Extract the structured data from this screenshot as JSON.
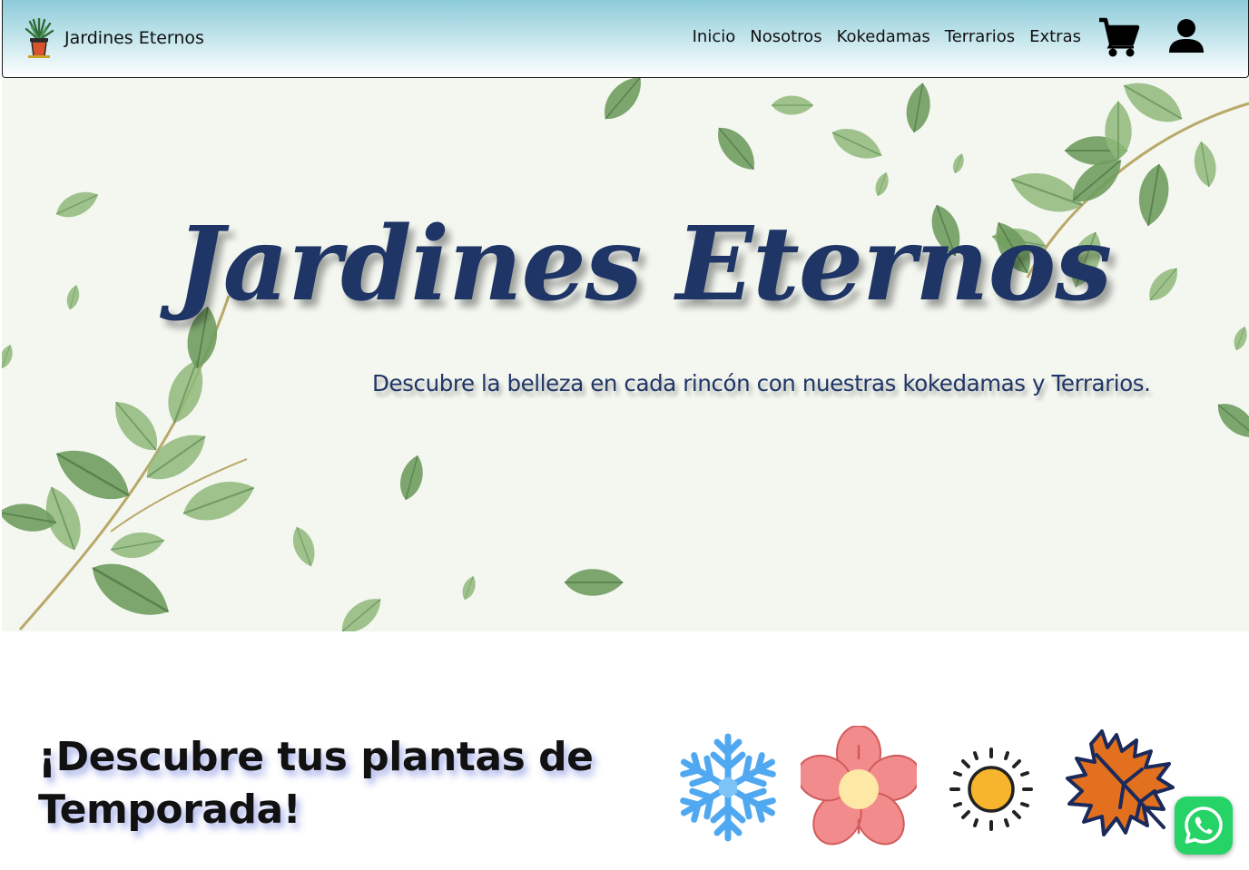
{
  "navbar": {
    "brand_name": "Jardines Eternos",
    "links": [
      {
        "label": "Inicio"
      },
      {
        "label": "Nosotros"
      },
      {
        "label": "Kokedamas"
      },
      {
        "label": "Terrarios"
      },
      {
        "label": "Extras"
      }
    ],
    "icons": {
      "logo": "potted-plant-icon",
      "cart": "shopping-cart-icon",
      "user": "user-account-icon"
    }
  },
  "hero": {
    "title": "Jardines Eternos",
    "subtitle": "Descubre la belleza en cada rincón con nuestras kokedamas y Terrarios.",
    "background": "watercolor-leaves",
    "title_color": "#1f3566"
  },
  "seasons": {
    "heading": "¡Descubre tus plantas de Temporada!",
    "icons": [
      {
        "name": "winter-snowflake-icon",
        "color": "#4fa8f0"
      },
      {
        "name": "spring-flower-icon",
        "color": "#f28b8b"
      },
      {
        "name": "summer-sun-icon",
        "color": "#f6b52c"
      },
      {
        "name": "autumn-leaf-icon",
        "color": "#e2701f"
      }
    ]
  },
  "whatsapp": {
    "icon": "whatsapp-icon",
    "color": "#25d366"
  }
}
